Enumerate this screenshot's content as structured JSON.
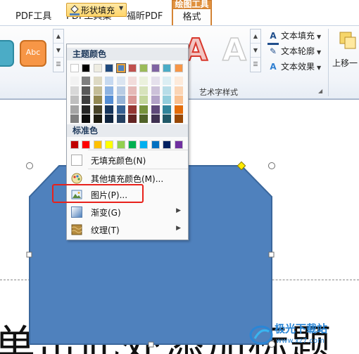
{
  "tabs": [
    "PDF工具",
    "PDF工具集",
    "福昕PDF"
  ],
  "context_tab": {
    "group": "绘图工具",
    "active": "格式"
  },
  "ribbon": {
    "style_tile_label": "Abc",
    "shape_fill_label": "形状填充",
    "wordart_letter": "A",
    "commands": [
      "文本填充",
      "文本轮廓",
      "文本效果"
    ],
    "group_label": "艺术字样式",
    "move_up_label": "上移一"
  },
  "menu": {
    "theme_header": "主题颜色",
    "standard_header": "标准色",
    "theme_top_row": [
      "#ffffff",
      "#000000",
      "#eeece1",
      "#1f497d",
      "#4f81bd",
      "#c0504d",
      "#9bbb59",
      "#8064a2",
      "#4bacc6",
      "#f79646"
    ],
    "theme_shades": [
      [
        "#f2f2f2",
        "#d8d8d8",
        "#bfbfbf",
        "#a5a5a5",
        "#7f7f7f"
      ],
      [
        "#7f7f7f",
        "#595959",
        "#3f3f3f",
        "#262626",
        "#0c0c0c"
      ],
      [
        "#ddd9c3",
        "#c4bd97",
        "#938953",
        "#494429",
        "#1d1b10"
      ],
      [
        "#c6d9f0",
        "#8db3e2",
        "#548dd4",
        "#17365d",
        "#0f243e"
      ],
      [
        "#dbe5f1",
        "#b8cce4",
        "#95b3d7",
        "#366092",
        "#244061"
      ],
      [
        "#f2dcdb",
        "#e5b9b7",
        "#d99694",
        "#953734",
        "#632423"
      ],
      [
        "#ebf1dd",
        "#d7e3bc",
        "#c3d69b",
        "#76923c",
        "#4f6128"
      ],
      [
        "#e5e0ec",
        "#ccc1d9",
        "#b2a2c7",
        "#5f497a",
        "#3f3151"
      ],
      [
        "#dbeef3",
        "#b7dde8",
        "#92cddc",
        "#31859b",
        "#205867"
      ],
      [
        "#fdeada",
        "#fbd5b5",
        "#fac08f",
        "#e36c09",
        "#974806"
      ]
    ],
    "standard_colors": [
      "#c00000",
      "#ff0000",
      "#ffc000",
      "#ffff00",
      "#92d050",
      "#00b050",
      "#00b0f0",
      "#0070c0",
      "#002060",
      "#7030a0"
    ],
    "items": [
      {
        "label": "无填充颜色(N)"
      },
      {
        "label": "其他填充颜色(M)..."
      },
      {
        "label": "图片(P)..."
      },
      {
        "label": "渐变(G)"
      },
      {
        "label": "纹理(T)"
      }
    ]
  },
  "document": {
    "visible_text": "单击此处添加标题"
  },
  "watermark": {
    "name": "极光下载站",
    "url": "www.xz7.com"
  }
}
